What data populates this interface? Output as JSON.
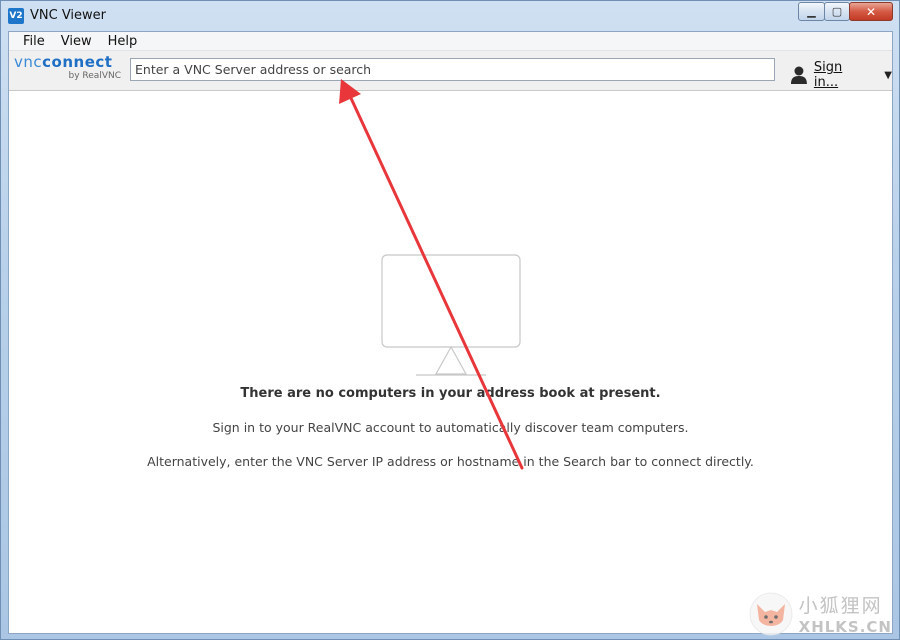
{
  "window": {
    "title": "VNC Viewer",
    "app_icon_text": "V2",
    "controls": {
      "minimize": "▁",
      "maximize": "▢",
      "close": "✕"
    }
  },
  "menu": {
    "items": [
      {
        "label": "File"
      },
      {
        "label": "View"
      },
      {
        "label": "Help"
      }
    ]
  },
  "toolbar": {
    "logo": {
      "main_a": "vnc",
      "main_b": "connect",
      "sub": "by RealVNC"
    },
    "search": {
      "placeholder": "Enter a VNC Server address or search",
      "value": ""
    },
    "signin_label": "Sign in...",
    "icons": {
      "user": "user-icon",
      "dropdown": "chevron-down-icon"
    }
  },
  "empty_state": {
    "title": "There are no computers in your address book at present.",
    "line1": "Sign in to your RealVNC account to automatically discover team computers.",
    "line2": "Alternatively, enter the VNC Server IP address or hostname in the Search bar to connect directly."
  },
  "colors": {
    "accent": "#1f70c4",
    "annotation": "#e8363a",
    "close_button": "#c33a25"
  },
  "watermark": {
    "cn": "小狐狸网",
    "en": "XHLKS.CN"
  }
}
